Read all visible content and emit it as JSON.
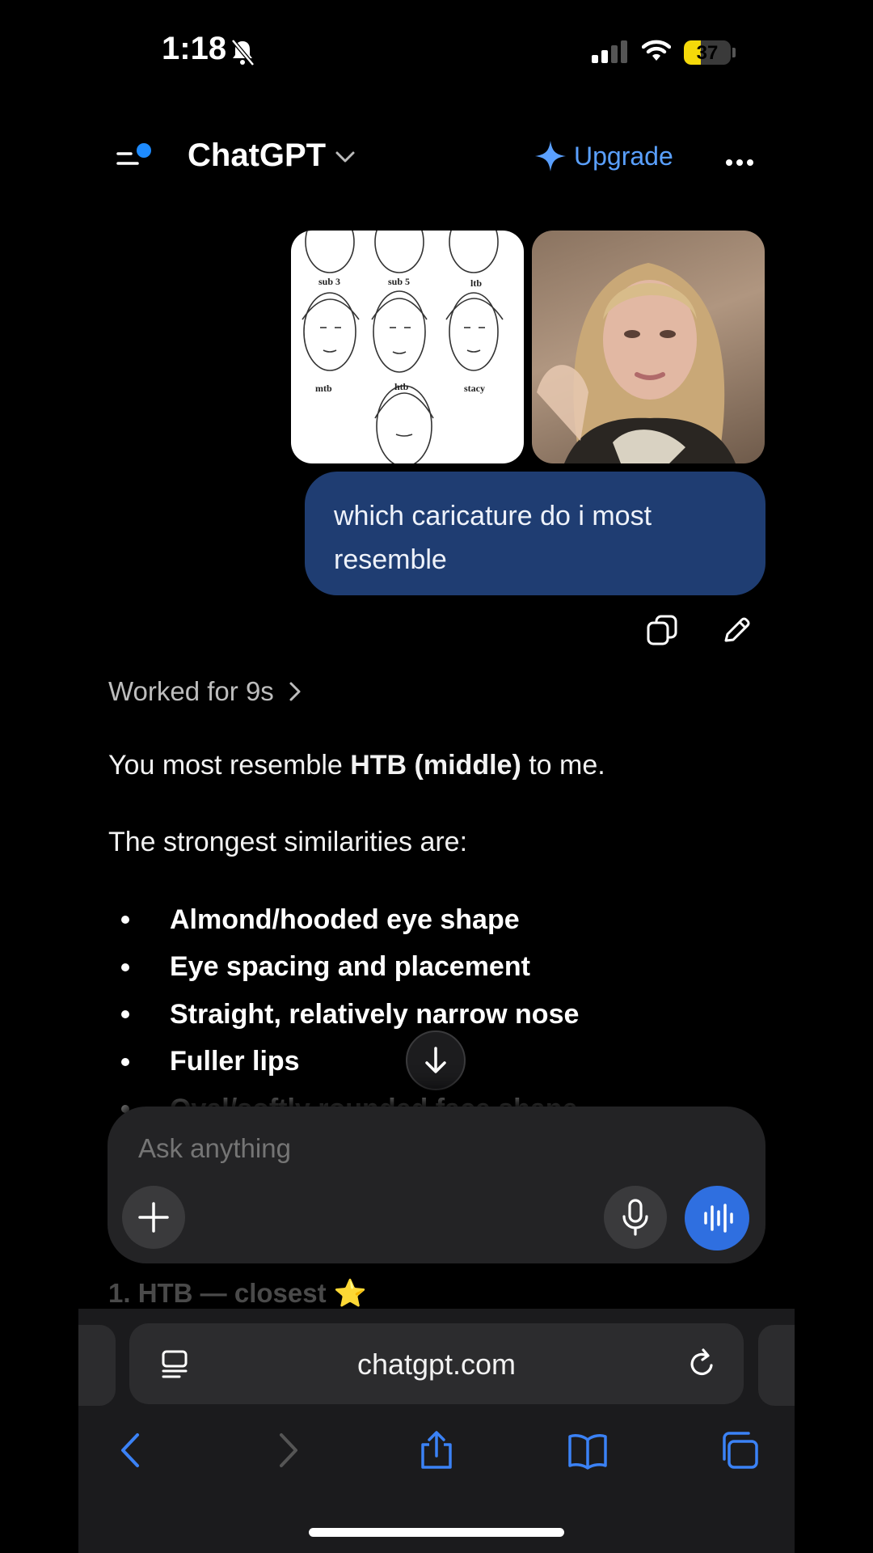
{
  "status": {
    "time": "1:18",
    "battery": "37",
    "battery_level": 0.37
  },
  "header": {
    "title": "ChatGPT",
    "upgrade_label": "Upgrade"
  },
  "caricature_labels": [
    "sub 3",
    "sub 5",
    "ltb",
    "mtb",
    "htb",
    "stacy"
  ],
  "user_message": "which caricature do i most resemble",
  "response": {
    "worked_label": "Worked for 9s",
    "line1_prefix": "You most resemble ",
    "line1_bold": "HTB (middle)",
    "line1_suffix": " to me.",
    "line2": "The strongest similarities are:",
    "bullets": [
      "Almond/hooded eye shape",
      "Eye spacing and placement",
      "Straight, relatively narrow nose",
      "Fuller lips",
      "Oval/softly rounded face shape"
    ],
    "faded_heading": "1. HTB — closest ⭐"
  },
  "composer": {
    "placeholder": "Ask anything"
  },
  "browser": {
    "url": "chatgpt.com"
  },
  "colors": {
    "bubble": "#1f3d72",
    "accent": "#5aa0ff",
    "voice_button": "#2f6fe0",
    "battery": "#f5d90a"
  }
}
